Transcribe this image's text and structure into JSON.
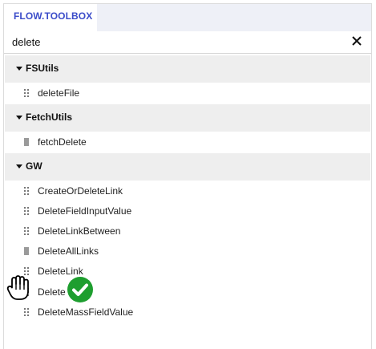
{
  "tab": {
    "label": "FLOW.TOOLBOX"
  },
  "search": {
    "value": "delete",
    "clear_icon": "close-icon"
  },
  "groups": [
    {
      "name": "FSUtils",
      "items": [
        "deleteFile"
      ]
    },
    {
      "name": "FetchUtils",
      "items": [
        "fetchDelete"
      ]
    },
    {
      "name": "GW",
      "items": [
        "CreateOrDeleteLink",
        "DeleteFieldInputValue",
        "DeleteLinkBetween",
        "DeleteAllLinks",
        "DeleteLink",
        "Delete",
        "DeleteMassFieldValue"
      ]
    }
  ],
  "overlay": {
    "cursor_icon": "grab-hand-icon",
    "status_icon": "check-circle-icon",
    "status_color": "#1e9e2f"
  },
  "colors": {
    "accent": "#3b4cc9",
    "group_bg": "#eeeeee"
  }
}
